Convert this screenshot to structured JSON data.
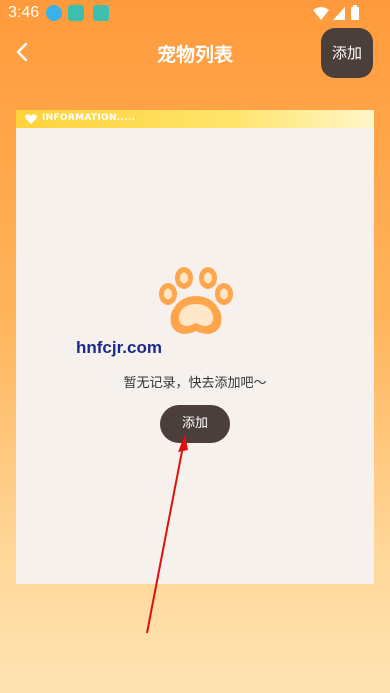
{
  "status_bar": {
    "time": "3:46"
  },
  "nav": {
    "title": "宠物列表",
    "add_label": "添加"
  },
  "card": {
    "header_label": "INFORMATION.....",
    "empty_text": "暂无记录，快去添加吧～",
    "add_label": "添加"
  },
  "watermark": "hnfcjr.com",
  "colors": {
    "accent": "#ff9a3c",
    "button": "#4a3f3a",
    "paw": "#ffa64d",
    "arrow": "#e01010"
  }
}
